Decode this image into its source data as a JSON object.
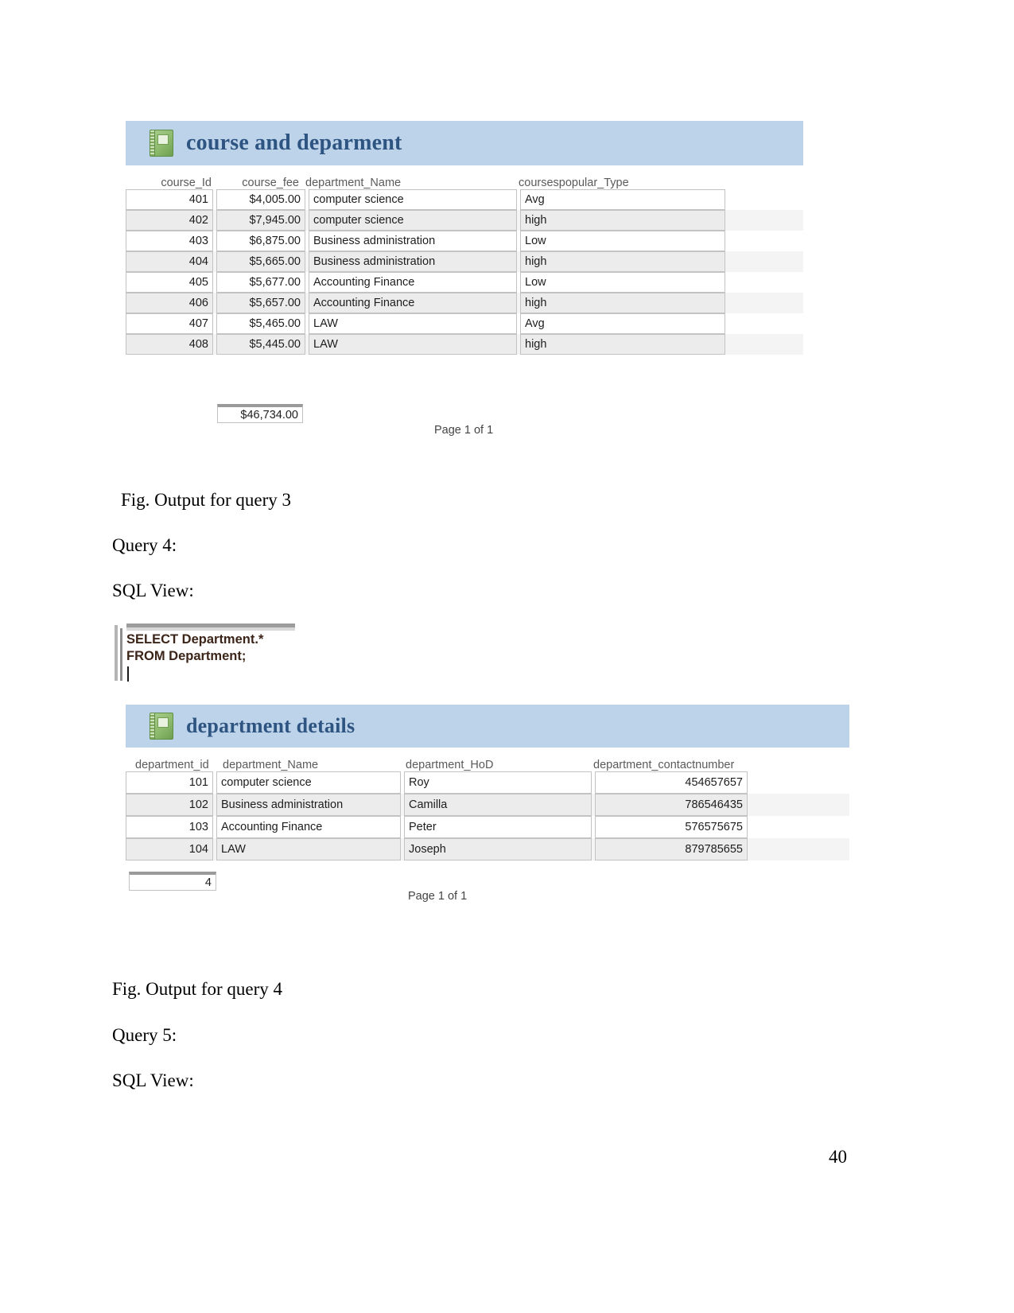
{
  "page": {
    "number": "40"
  },
  "report_course": {
    "title": "course and deparment",
    "icon": "notebook-icon",
    "columns": [
      "course_Id",
      "course_fee",
      "department_Name",
      "coursespopular_Type"
    ],
    "rows": [
      {
        "course_Id": "401",
        "course_fee": "$4,005.00",
        "department_Name": "computer science",
        "coursespopular_Type": "Avg"
      },
      {
        "course_Id": "402",
        "course_fee": "$7,945.00",
        "department_Name": "computer science",
        "coursespopular_Type": "high"
      },
      {
        "course_Id": "403",
        "course_fee": "$6,875.00",
        "department_Name": "Business administration",
        "coursespopular_Type": "Low"
      },
      {
        "course_Id": "404",
        "course_fee": "$5,665.00",
        "department_Name": "Business administration",
        "coursespopular_Type": "high"
      },
      {
        "course_Id": "405",
        "course_fee": "$5,677.00",
        "department_Name": "Accounting Finance",
        "coursespopular_Type": "Low"
      },
      {
        "course_Id": "406",
        "course_fee": "$5,657.00",
        "department_Name": "Accounting Finance",
        "coursespopular_Type": "high"
      },
      {
        "course_Id": "407",
        "course_fee": "$5,465.00",
        "department_Name": "LAW",
        "coursespopular_Type": "Avg"
      },
      {
        "course_Id": "408",
        "course_fee": "$5,445.00",
        "department_Name": "LAW",
        "coursespopular_Type": "high"
      }
    ],
    "total": "$46,734.00",
    "page_footer": "Page 1 of 1"
  },
  "caption_query3": "Fig. Output  for query 3",
  "query4_label": "Query 4:",
  "sql_view_label_1": "SQL View:",
  "sql_query4": "SELECT Department.*\nFROM Department;",
  "report_department": {
    "title": "department details",
    "icon": "notebook-icon",
    "columns": [
      "department_id",
      "department_Name",
      "department_HoD",
      "department_contactnumber"
    ],
    "rows": [
      {
        "department_id": "101",
        "department_Name": "computer science",
        "department_HoD": "Roy",
        "department_contactnumber": "454657657"
      },
      {
        "department_id": "102",
        "department_Name": "Business administration",
        "department_HoD": "Camilla",
        "department_contactnumber": "786546435"
      },
      {
        "department_id": "103",
        "department_Name": "Accounting Finance",
        "department_HoD": "Peter",
        "department_contactnumber": "576575675"
      },
      {
        "department_id": "104",
        "department_Name": "LAW",
        "department_HoD": "Joseph",
        "department_contactnumber": "879785655"
      }
    ],
    "total": "4",
    "page_footer": "Page 1 of 1"
  },
  "caption_query4": "Fig. Output  for query 4",
  "query5_label": "Query 5:",
  "sql_view_label_2": "SQL View:"
}
